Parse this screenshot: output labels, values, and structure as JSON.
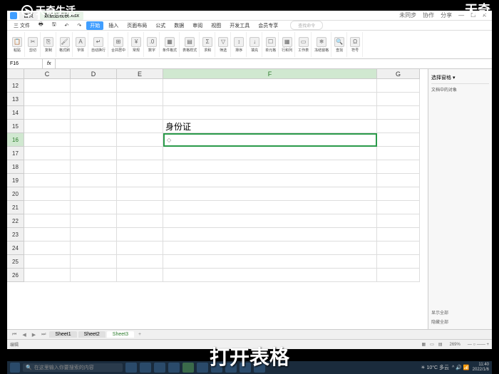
{
  "brand": {
    "logo_text": "天奇生活",
    "right_text": "天奇"
  },
  "titlebar": {
    "tabs": [
      "首页",
      "数据透视表.xlsx"
    ],
    "right": [
      "未同步",
      "协作",
      "分享"
    ]
  },
  "menubar": {
    "items": [
      "三 文件",
      "🖶",
      "🖫",
      "↶",
      "↷",
      "开始",
      "插入",
      "页面布局",
      "公式",
      "数据",
      "审阅",
      "视图",
      "开发工具",
      "会员专享"
    ],
    "search_placeholder": "查找命令"
  },
  "ribbon": {
    "groups": [
      "粘贴",
      "剪切",
      "复制",
      "格式刷",
      "字体",
      "自动换行",
      "合并居中",
      "常规",
      "数字",
      "条件格式",
      "表格样式",
      "求和",
      "筛选",
      "排序",
      "填充",
      "单元格",
      "行和列",
      "工作表",
      "冻结窗格",
      "查找",
      "符号"
    ]
  },
  "formula": {
    "name_box": "F16",
    "fx": "fx",
    "content": ""
  },
  "columns": [
    "C",
    "D",
    "E",
    "F",
    "G"
  ],
  "rows": [
    12,
    13,
    14,
    15,
    16,
    17,
    18,
    19,
    20,
    21,
    22,
    23,
    24,
    25,
    26
  ],
  "cells": {
    "F15": "身份证"
  },
  "selected": {
    "row": 16,
    "col": "F"
  },
  "side_panel": {
    "title": "选择窗格 ▾",
    "sub": "文档中的对象",
    "footer1": "显示全部",
    "footer2": "隐藏全部"
  },
  "sheets": {
    "tabs": [
      "Sheet1",
      "Sheet2",
      "Sheet3"
    ],
    "active": 2
  },
  "status": {
    "left": "编辑",
    "zoom": "269%",
    "zoom_ctrl": "— ○ —— +"
  },
  "taskbar": {
    "search_placeholder": "在这里输入你要搜索的内容",
    "weather": "☀ 10°C 多云",
    "time": "11:40",
    "date": "2022/1/6"
  },
  "subtitle": "打开表格"
}
